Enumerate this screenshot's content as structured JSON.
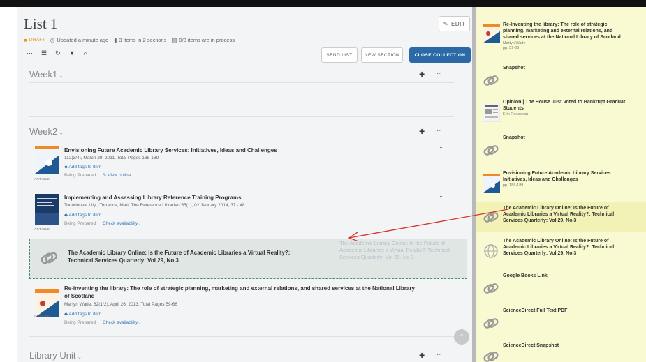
{
  "header": {
    "list_title": "List 1",
    "edit_label": "EDIT",
    "draft_badge": "DRAFT",
    "updated": "Updated a minute ago",
    "items_count": "3 items in 2 sections",
    "in_process": "0/3 items are in process"
  },
  "toolbar": {
    "send_list": "SEND LIST",
    "new_section": "NEW SECTION",
    "close_collection": "CLOSE COLLECTION",
    "tool_icons": [
      "more-icon",
      "list-view-icon",
      "refresh-icon",
      "filter-icon",
      "search-icon"
    ]
  },
  "sections": [
    {
      "title": "Week1",
      "chevron": "⌄",
      "plus": "+",
      "more": "···"
    },
    {
      "title": "Week2",
      "chevron": "⌄",
      "plus": "+",
      "more": "···"
    },
    {
      "title": "Library Unit",
      "chevron": "⌄",
      "plus": "+",
      "more": "···"
    }
  ],
  "items": [
    {
      "title": "Envisioning Future Academic Library Services: Initiatives, Ideas and Challenges",
      "sub": "112(3/4), March 29, 2011, Total Pages 188-189",
      "tags": "Add tags to item",
      "status": "Being Prepared",
      "link": "View online",
      "type": "ARTICLE",
      "more": "···"
    },
    {
      "title": "Implementing and Assessing Library Reference Training Programs",
      "sub": "Todorinova, Lily ; Torrence, Matt, The Reference Librarian 55(1), 02 January 2014, 37 - 48",
      "tags": "Add tags to item",
      "status": "Being Prepared",
      "link": "Check availability ›",
      "type": "ARTICLE",
      "more": "···"
    },
    {
      "title_line1": "Re-inventing the library: The role of strategic planning, marketing and external relations, and shared services at the National Library",
      "title_line2": "of Scotland",
      "sub": "Martyn Wade, 62(1/2), April 26, 2013, Total Pages 59-66",
      "tags": "Add tags to item",
      "status": "Being Prepared",
      "link": "Check availability ›",
      "type": "ARTICLE",
      "more": "···"
    }
  ],
  "dropzone": {
    "line1": "The Academic Library Online: Is the Future of Academic Libraries a Virtual Reality?:",
    "line2": "Technical Services Quarterly: Vol 29, No 3",
    "ghost_line1": "The Academic Library Online: Is the Future of",
    "ghost_line2": "Academic Libraries a Virtual Reality?: Technical",
    "ghost_line3": "Services Quarterly: Vol 29, No 3"
  },
  "sidebar": {
    "items": [
      {
        "l1": "Re-Inventing the library: The role of strategic",
        "l2": "planning, marketing and external relations, and",
        "l3": "shared services at the National Library of Scotland",
        "sub1": "Martyn Wade",
        "sub2": "pp. 59-66"
      },
      {
        "l1": "Snapshot"
      },
      {
        "l1": "Opinion | The House Just Voted to Bankrupt Graduat",
        "l2": "Students",
        "sub1": "Erin Rousseau"
      },
      {
        "l1": "Snapshot"
      },
      {
        "l1": "Envisioning Future Academic Library Services:",
        "l2": "Initiatives, Ideas and Challenges",
        "sub1": "pp. 188-189"
      },
      {
        "l1": "The Academic Library Online: Is the Future of",
        "l2": "Academic Libraries a Virtual Reality?: Technical",
        "l3": "Services Quarterly: Vol 29, No 3"
      },
      {
        "l1": "The Academic Library Online: Is the Future of",
        "l2": "Academic Libraries a Virtual Reality?: Technical",
        "l3": "Services Quarterly: Vol 29, No 3"
      },
      {
        "l1": "Google Books Link"
      },
      {
        "l1": "ScienceDirect Full Text PDF"
      },
      {
        "l1": "ScienceDirect Snapshot"
      }
    ]
  },
  "colors": {
    "accent": "#2b6aa6",
    "draft": "#e39a21",
    "sidebar_bg": "#fafad2",
    "arrow": "#d9332b"
  }
}
